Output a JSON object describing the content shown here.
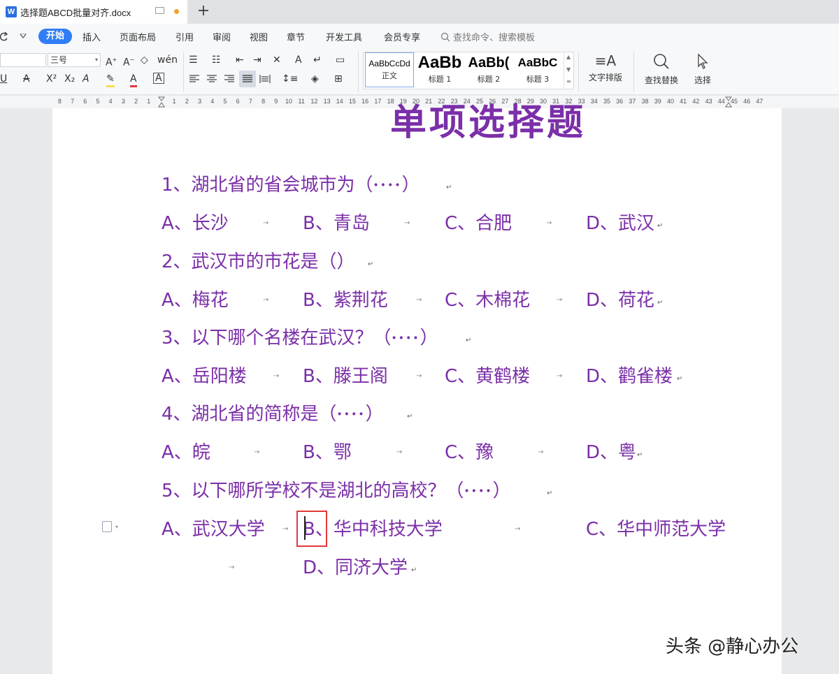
{
  "window": {
    "doc_tab_title": "选择题ABCD批量对齐.docx",
    "new_tab": "+"
  },
  "menu": {
    "active": "开始",
    "items": [
      "插入",
      "页面布局",
      "引用",
      "审阅",
      "视图",
      "章节",
      "开发工具",
      "会员专享"
    ],
    "search_placeholder": "查找命令、搜索模板"
  },
  "ribbon": {
    "font_size": "三号",
    "styles": [
      {
        "sample": "AaBbCcDd",
        "label": "正文"
      },
      {
        "sample": "AaBb",
        "label": "标题 1"
      },
      {
        "sample": "AaBb(",
        "label": "标题 2"
      },
      {
        "sample": "AaBbC",
        "label": "标题 3"
      }
    ],
    "text_layout": "文字排版",
    "find_replace": "查找替换",
    "select": "选择"
  },
  "ruler": {
    "left": [
      "8",
      "7",
      "6",
      "5",
      "4",
      "3",
      "2",
      "1"
    ],
    "right": [
      "1",
      "2",
      "3",
      "4",
      "5",
      "6",
      "7",
      "8",
      "9",
      "10",
      "11",
      "12",
      "13",
      "14",
      "15",
      "16",
      "17",
      "18",
      "19",
      "20",
      "21",
      "22",
      "23",
      "24",
      "25",
      "26",
      "27",
      "28",
      "29",
      "30",
      "31",
      "32",
      "33",
      "34",
      "35",
      "36",
      "37",
      "38",
      "39",
      "40",
      "41",
      "42",
      "43",
      "44",
      "45",
      "46",
      "47"
    ]
  },
  "document": {
    "title": "单项选择题",
    "questions": [
      {
        "q": "1、湖北省的省会城市为（",
        "q_end": "）",
        "dots": "••••",
        "options": [
          "A、长沙",
          "B、青岛",
          "C、合肥",
          "D、武汉"
        ]
      },
      {
        "q": "2、武汉市的市花是（）",
        "q_end": "",
        "dots": "",
        "options": [
          "A、梅花",
          "B、紫荆花",
          "C、木棉花",
          "D、荷花"
        ]
      },
      {
        "q": "3、以下哪个名楼在武汉？（",
        "q_end": "）",
        "dots": "••••",
        "options": [
          "A、岳阳楼",
          "B、滕王阁",
          "C、黄鹤楼",
          "D、鹳雀楼"
        ]
      },
      {
        "q": "4、湖北省的简称是（",
        "q_end": "）",
        "dots": "••••",
        "options": [
          "A、皖",
          "B、鄂",
          "C、豫",
          "D、粤"
        ]
      },
      {
        "q": "5、以下哪所学校不是湖北的高校？（",
        "q_end": "）",
        "dots": "••••",
        "options": [
          "A、武汉大学",
          "B、华中科技大学",
          "C、华中师范大学",
          "D、同济大学"
        ]
      }
    ]
  },
  "watermark": "头条 @静心办公",
  "colors": {
    "text": "#7b2fa8",
    "accent": "#2f7ef5",
    "highlight_box": "#e23a3a"
  }
}
